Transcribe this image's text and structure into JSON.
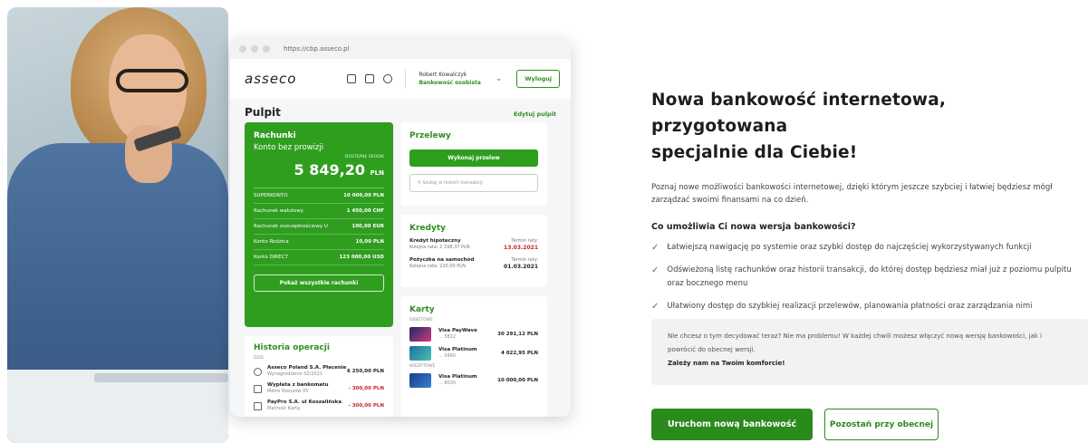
{
  "mockup": {
    "url": "https://cbp.asseco.pl",
    "logo": "asseco",
    "user_name": "Robert Kowalczyk",
    "user_role": "Bankowość osobista",
    "logout": "Wyloguj",
    "page_title": "Pulpit",
    "edit_link": "Edytuj pulpit",
    "accounts": {
      "title": "Rachunki",
      "name": "Konto bez prowizji",
      "available_label": "DOSTĘPNE ŚRODKI",
      "balance": "5 849,20",
      "currency": "PLN",
      "rows": [
        {
          "name": "SUPERKONTO",
          "value": "10 000,00 PLN"
        },
        {
          "name": "Rachunek walutowy",
          "value": "1 450,00 CHF"
        },
        {
          "name": "Rachunek oszczędnościowy U",
          "value": "100,00 EUR"
        },
        {
          "name": "Konto Rodzica",
          "value": "10,00 PLN"
        },
        {
          "name": "Konto DIRECT",
          "value": "123 000,00 USD"
        }
      ],
      "show_all": "Pokaż wszystkie rachunki"
    },
    "transfers": {
      "title": "Przelewy",
      "button": "Wykonaj przelew",
      "search_placeholder": "Szukaj w historii transakcji"
    },
    "loans": {
      "title": "Kredyty",
      "items": [
        {
          "name": "Kredyt hipoteczny",
          "sub": "Kolejna rata: 2 198,37 PLN",
          "term_label": "Termin raty:",
          "date": "13.03.2021"
        },
        {
          "name": "Pożyczka na samochód",
          "sub": "Kolejna rata: 220,00 PLN",
          "term_label": "Termin raty:",
          "date": "01.03.2021"
        }
      ]
    },
    "history": {
      "title": "Historia operacji",
      "day": "DZIŚ",
      "items": [
        {
          "name": "Asseco Poland S.A. Płacenie",
          "sub": "Wynagrodzenie 02/2021",
          "amount": "6 250,00 PLN"
        },
        {
          "name": "Wypłata z bankomatu",
          "sub": "Metro Rzeszów 05",
          "amount": "- 300,00 PLN"
        },
        {
          "name": "PayPro S.A. ul Koszalińska",
          "sub": "Płatność Kartą",
          "amount": "- 300,00 PLN"
        }
      ]
    },
    "cards": {
      "title": "Karty",
      "debit_label": "DEBETOWE",
      "credit_label": "KREDYTOWE",
      "debit": [
        {
          "name": "Visa PayWave",
          "sub": "... 5812",
          "amount": "30 291,12 PLN"
        },
        {
          "name": "Visa Platinum",
          "sub": "... 0460",
          "amount": "4 022,95 PLN"
        }
      ],
      "credit": [
        {
          "name": "Visa Platinum",
          "sub": "... 8020",
          "amount": "10 000,00 PLN"
        }
      ]
    }
  },
  "content": {
    "headline_1": "Nowa bankowość internetowa, przygotowana",
    "headline_2": "specjalnie dla Ciebie!",
    "lead": "Poznaj nowe możliwości bankowości internetowej, dzięki którym jeszcze szybciej i łatwiej będziesz mógł zarządzać swoimi finansami na co dzień.",
    "question": "Co umożliwia Ci nowa wersja bankowości?",
    "bullets": [
      "Łatwiejszą nawigację po systemie oraz szybki dostęp do najczęściej wykorzystywanych funkcji",
      "Odświeżoną listę rachunków oraz historii transakcji, do której dostęp będziesz miał już z poziomu pulpitu oraz bocznego menu",
      "Ułatwiony dostęp do szybkiej realizacji przelewów, planowania płatności oraz zarządzania nimi"
    ],
    "note_1": "Nie chcesz o tym decydować teraz? Nie ma problemu! W każdej chwili możesz włączyć nową wersję bankowości, jak i powrócić do obecnej wersji.",
    "note_2": "Zależy nam na Twoim komforcie!",
    "primary_button": "Uruchom nową bankowość",
    "secondary_button": "Pozostań przy obecnej"
  },
  "colors": {
    "brand_green": "#2b8a1c",
    "card_green": "#2f9e1f",
    "note_bg": "#f1f2f4"
  },
  "icons": [
    "cart-icon",
    "mail-icon",
    "gear-icon",
    "chevron-down-icon",
    "search-icon",
    "check-icon"
  ]
}
